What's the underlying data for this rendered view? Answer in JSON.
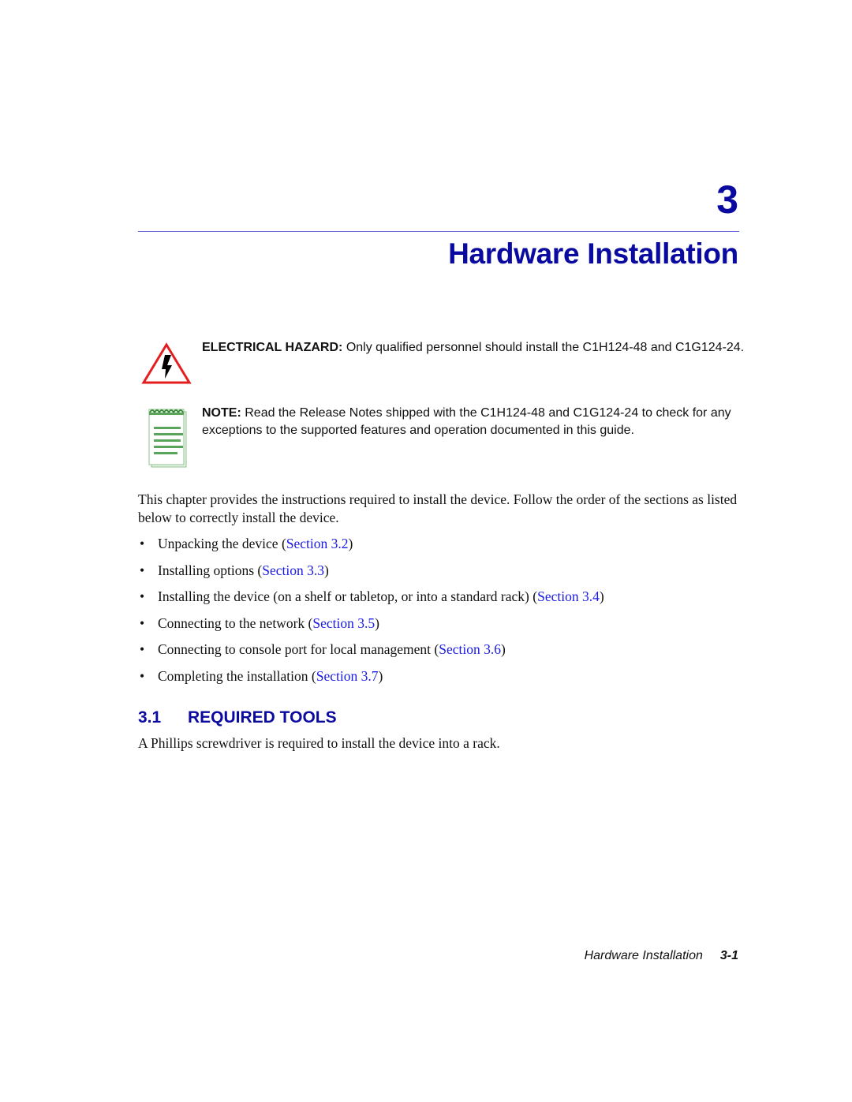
{
  "chapter": {
    "number": "3",
    "title": "Hardware Installation"
  },
  "hazard": {
    "icon": "electrical-hazard-icon",
    "label": "ELECTRICAL HAZARD:",
    "text": "Only qualified personnel should install the C1H124-48 and C1G124-24.",
    "colors": {
      "triangle": "#e41e1e",
      "bolt": "#000000"
    }
  },
  "note": {
    "icon": "notepad-icon",
    "label": "NOTE:",
    "text": "Read the Release Notes shipped with the C1H124-48 and C1G124-24 to check for any exceptions to the supported features and operation documented in this guide.",
    "colors": {
      "pad": "#5aa55a"
    }
  },
  "intro": "This chapter provides the instructions required to install the device. Follow the order of the sections as listed below to correctly install the device.",
  "bullets": [
    {
      "text": "Unpacking the device",
      "link": "Section 3.2"
    },
    {
      "text": "Installing options",
      "link": "Section 3.3"
    },
    {
      "text": "Installing the device (on a shelf or tabletop, or into a standard rack)",
      "link": "Section 3.4"
    },
    {
      "text": "Connecting to the network",
      "link": "Section 3.5"
    },
    {
      "text": "Connecting to console port for local management",
      "link": "Section 3.6"
    },
    {
      "text": "Completing the installation",
      "link": "Section 3.7"
    }
  ],
  "section": {
    "number": "3.1",
    "title": "REQUIRED TOOLS",
    "body": "A Phillips screwdriver is required to install the device into a rack."
  },
  "footer": {
    "title": "Hardware Installation",
    "page": "3-1"
  },
  "colors": {
    "heading": "#0a0aa0",
    "link": "#1a1ae6",
    "rule": "#6b6bd8"
  }
}
